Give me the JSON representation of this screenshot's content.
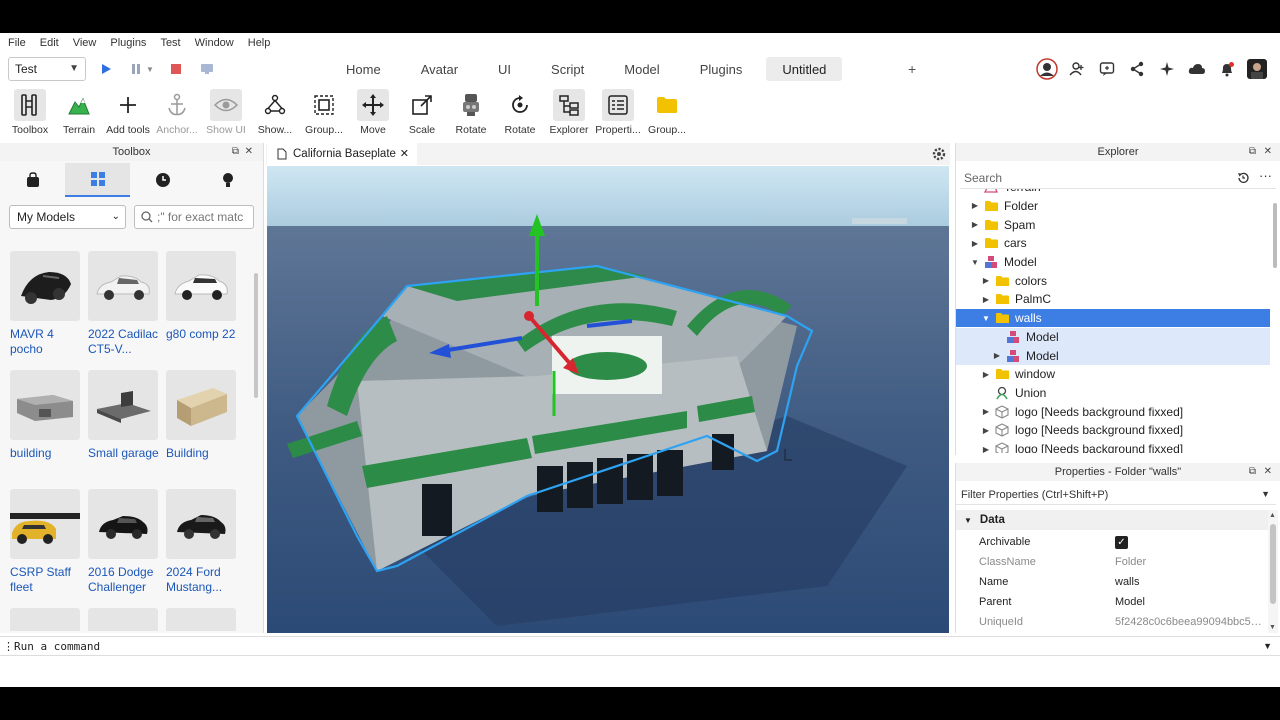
{
  "menu": [
    "File",
    "Edit",
    "View",
    "Plugins",
    "Test",
    "Window",
    "Help"
  ],
  "topbar": {
    "config_value": "Test",
    "tabs": [
      "Home",
      "Avatar",
      "UI",
      "Script",
      "Model",
      "Plugins",
      "Untitled"
    ],
    "active_tab": "Untitled",
    "plus": "+"
  },
  "ribbon": [
    {
      "label": "Toolbox",
      "icon": "toolbox-icon"
    },
    {
      "label": "Terrain",
      "icon": "terrain-icon"
    },
    {
      "label": "Add tools",
      "icon": "plus-icon"
    },
    {
      "label": "Anchor...",
      "icon": "anchor-icon"
    },
    {
      "label": "Show UI",
      "icon": "eye-icon"
    },
    {
      "label": "Show...",
      "icon": "show-hierarchy-icon"
    },
    {
      "label": "Group...",
      "icon": "group-icon"
    },
    {
      "label": "Move",
      "icon": "move-icon"
    },
    {
      "label": "Scale",
      "icon": "scale-icon"
    },
    {
      "label": "Rotate",
      "icon": "rotate-part-icon"
    },
    {
      "label": "Rotate",
      "icon": "rotate-icon"
    },
    {
      "label": "Explorer",
      "icon": "explorer-icon"
    },
    {
      "label": "Properti...",
      "icon": "properties-icon"
    },
    {
      "label": "Group...",
      "icon": "folder-icon"
    }
  ],
  "toolbox": {
    "title": "Toolbox",
    "category": "My Models",
    "search_placeholder": ";\" for exact matc",
    "items": [
      {
        "name": "MAVR 4 pocho"
      },
      {
        "name": "2022 Cadilac CT5-V..."
      },
      {
        "name": "g80 comp 22"
      },
      {
        "name": "building"
      },
      {
        "name": "Small garage"
      },
      {
        "name": "Building"
      },
      {
        "name": "CSRP Staff fleet"
      },
      {
        "name": "2016 Dodge Challenger"
      },
      {
        "name": "2024 Ford Mustang..."
      }
    ]
  },
  "viewport": {
    "tab_title": "California Baseplate"
  },
  "explorer": {
    "title": "Explorer",
    "search_placeholder": "Search",
    "nodes": [
      {
        "label": "Terrain",
        "depth": 0,
        "arrow": "",
        "icon": "terrain"
      },
      {
        "label": "Folder",
        "depth": 0,
        "arrow": "▶",
        "icon": "folder"
      },
      {
        "label": "Spam",
        "depth": 0,
        "arrow": "▶",
        "icon": "folder"
      },
      {
        "label": "cars",
        "depth": 0,
        "arrow": "▶",
        "icon": "folder"
      },
      {
        "label": "Model",
        "depth": 0,
        "arrow": "▼",
        "icon": "model"
      },
      {
        "label": "colors",
        "depth": 1,
        "arrow": "▶",
        "icon": "folder"
      },
      {
        "label": "PalmC",
        "depth": 1,
        "arrow": "▶",
        "icon": "folder"
      },
      {
        "label": "walls",
        "depth": 1,
        "arrow": "▼",
        "icon": "folder",
        "state": "selected"
      },
      {
        "label": "Model",
        "depth": 2,
        "arrow": "",
        "icon": "model",
        "state": "child"
      },
      {
        "label": "Model",
        "depth": 2,
        "arrow": "▶",
        "icon": "model",
        "state": "child"
      },
      {
        "label": "window",
        "depth": 1,
        "arrow": "▶",
        "icon": "folder"
      },
      {
        "label": "Union",
        "depth": 1,
        "arrow": "",
        "icon": "union"
      },
      {
        "label": "logo [Needs background fixxed]",
        "depth": 1,
        "arrow": "▶",
        "icon": "mesh"
      },
      {
        "label": "logo [Needs background fixxed]",
        "depth": 1,
        "arrow": "▶",
        "icon": "mesh"
      },
      {
        "label": "logo [Needs background fixxed]",
        "depth": 1,
        "arrow": "▶",
        "icon": "mesh"
      }
    ]
  },
  "properties": {
    "title": "Properties - Folder \"walls\"",
    "filter_placeholder": "Filter Properties (Ctrl+Shift+P)",
    "category": "Data",
    "rows": [
      {
        "name": "Archivable",
        "value": "",
        "checked": true
      },
      {
        "name": "ClassName",
        "value": "Folder",
        "grey": true
      },
      {
        "name": "Name",
        "value": "walls"
      },
      {
        "name": "Parent",
        "value": "Model"
      },
      {
        "name": "UniqueId",
        "value": "5f2428c0c6beea99094bbc5e...",
        "grey": true
      }
    ]
  },
  "command_bar": {
    "placeholder": "Run a command"
  },
  "colors": {
    "accent": "#3d7ee5",
    "play": "#2f6fe0",
    "stop": "#e05656",
    "folder": "#f2c200",
    "gizmo_x": "#d7262f",
    "gizmo_y": "#22c322",
    "gizmo_z": "#2251d8"
  }
}
